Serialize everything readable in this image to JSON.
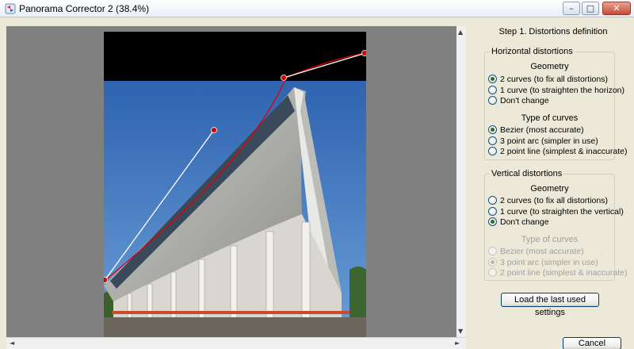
{
  "window": {
    "title": "Panorama Corrector 2 (38.4%)",
    "controls": {
      "minimize": "–",
      "maximize": "□",
      "close": "✕"
    }
  },
  "colors": {
    "handle": "#d90000",
    "curve": "#e00000",
    "guide": "#ffffff",
    "sky": "#3f78c0"
  },
  "panel": {
    "step_title": "Step 1. Distortions definition",
    "horizontal": {
      "legend": "Horizontal distortions",
      "geometry_label": "Geometry",
      "geometry_options": [
        {
          "label": "2 curves (to fix all distortions)",
          "checked": true
        },
        {
          "label": "1 curve  (to straighten the horizon)",
          "checked": false
        },
        {
          "label": "Don't change",
          "checked": false
        }
      ],
      "curve_type_label": "Type of curves",
      "curve_type_options": [
        {
          "label": "Bezier  (most accurate)",
          "checked": true
        },
        {
          "label": "3 point arc  (simpler in use)",
          "checked": false
        },
        {
          "label": "2 point line  (simplest & inaccurate)",
          "checked": false
        }
      ]
    },
    "vertical": {
      "legend": "Vertical distortions",
      "geometry_label": "Geometry",
      "geometry_options": [
        {
          "label": "2 curves (to fix all distortions)",
          "checked": false
        },
        {
          "label": "1 curve  (to straighten the vertical)",
          "checked": false
        },
        {
          "label": "Don't change",
          "checked": true
        }
      ],
      "curve_type_label": "Type of curves",
      "curve_type_options": [
        {
          "label": "Bezier  (most accurate)",
          "checked": false
        },
        {
          "label": "3 point arc  (simpler in use)",
          "checked": true
        },
        {
          "label": "2 point line  (simplest & inaccurate)",
          "checked": false
        }
      ]
    },
    "load_button": "Load the last used settings",
    "cancel_button": "Cancel"
  },
  "scroll": {
    "left": "◄",
    "right": "►",
    "up": "▲",
    "down": "▼"
  }
}
